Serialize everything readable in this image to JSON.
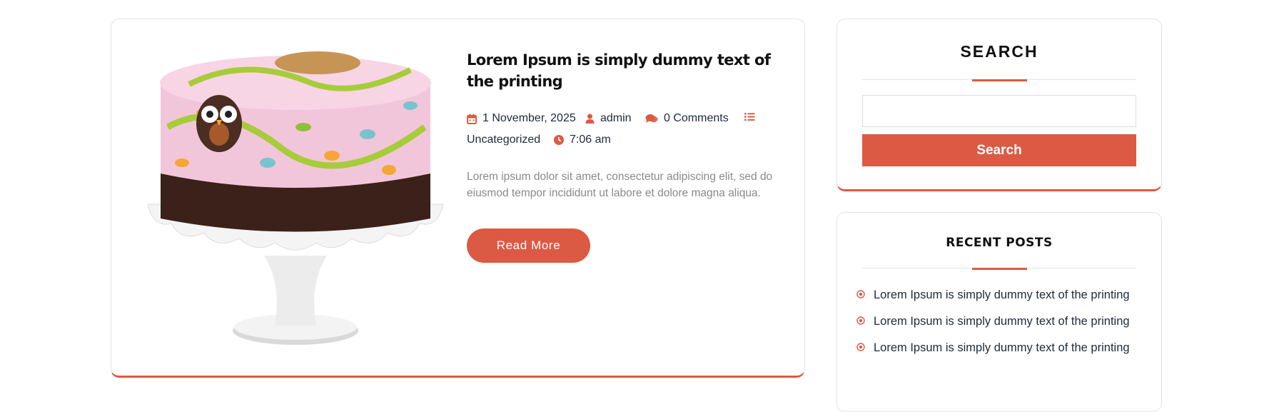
{
  "post": {
    "image_alt": "owl-decorated cake on white cake stand",
    "title": "Lorem Ipsum is simply dummy text of the printing",
    "meta": {
      "date": "1 November, 2025",
      "author": "admin",
      "comments": "0 Comments",
      "category": "Uncategorized",
      "time": "7:06 am"
    },
    "excerpt": "Lorem ipsum dolor sit amet, consectetur adipiscing elit, sed do eiusmod tempor incididunt ut labore et dolore magna aliqua.",
    "read_more_label": "Read More"
  },
  "sidebar": {
    "search": {
      "title": "SEARCH",
      "input_value": "",
      "button_label": "Search"
    },
    "recent_posts": {
      "title": "RECENT POSTS",
      "items": [
        "Lorem Ipsum is simply dummy text of the printing",
        "Lorem Ipsum is simply dummy text of the printing",
        "Lorem Ipsum is simply dummy text of the printing"
      ]
    }
  },
  "colors": {
    "accent": "#dc5a43",
    "text_dark": "#1f2a3c",
    "text_muted": "#8a8a8a",
    "border": "#e3e3e3"
  },
  "icons": {
    "date": "calendar-icon",
    "author": "user-icon",
    "comments": "comments-icon",
    "category": "list-icon",
    "time": "clock-icon",
    "recent_bullet": "circle-dot-icon"
  }
}
